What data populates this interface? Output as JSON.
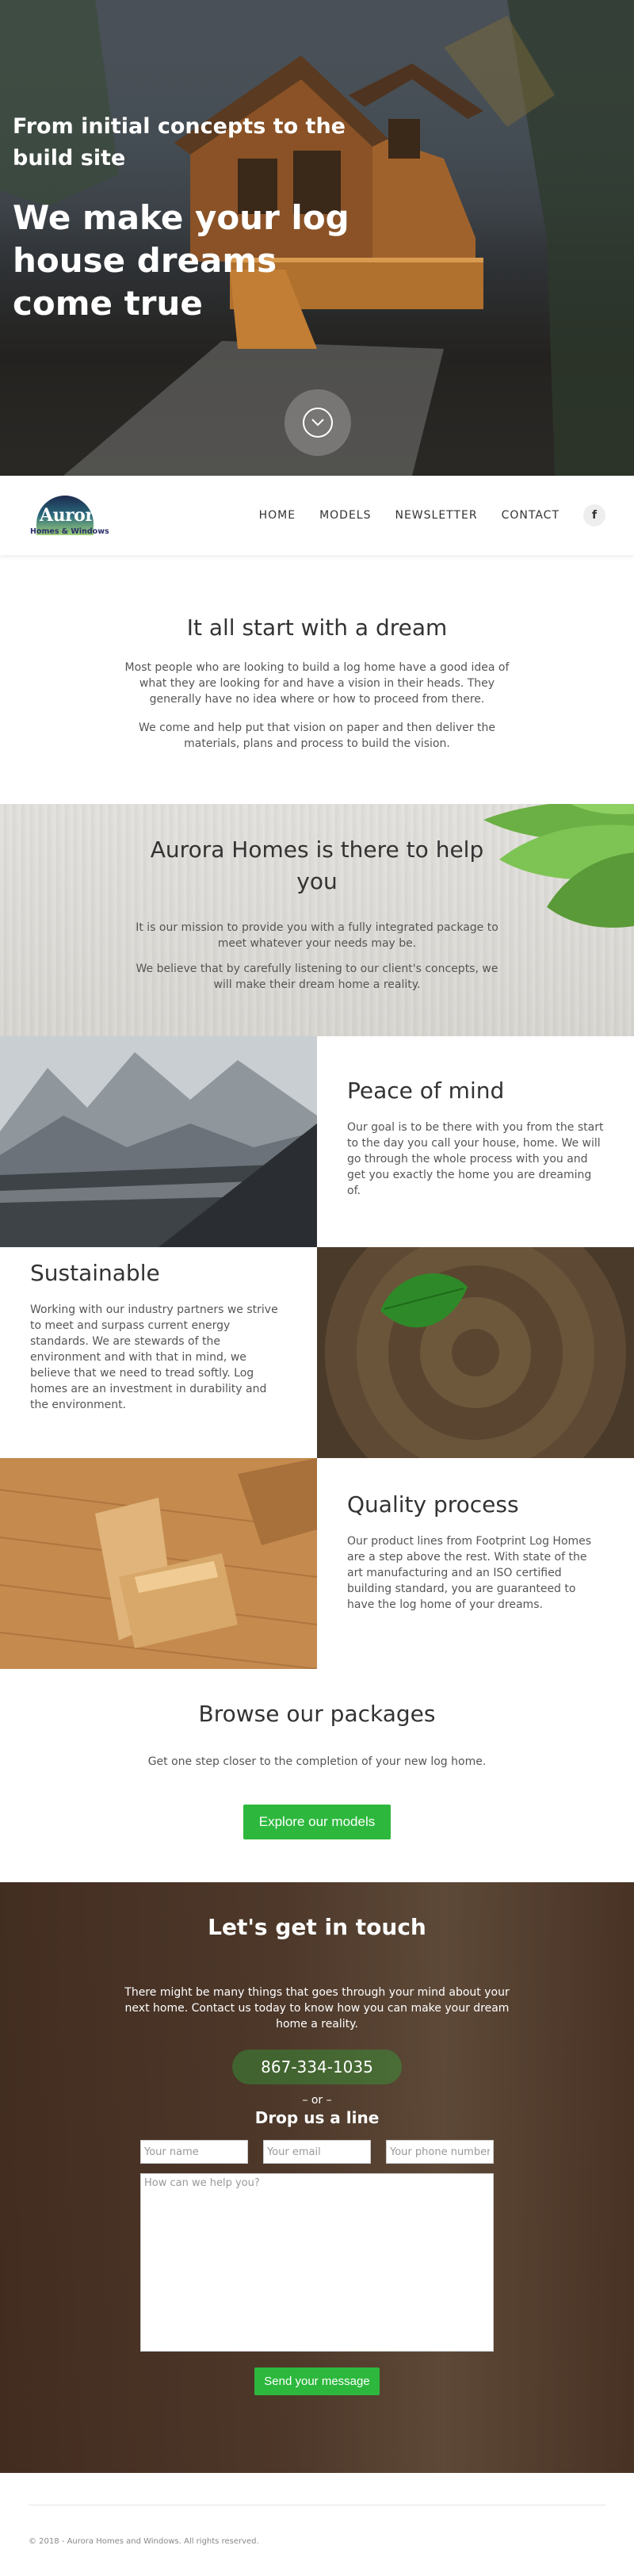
{
  "hero": {
    "subtitle": "From initial concepts to the build site",
    "title": "We make your log house dreams come true",
    "scroll_icon": "chevron-down-circle-icon"
  },
  "nav": {
    "logo_name": "Aurora",
    "logo_tag": "Homes & Windows",
    "items": [
      "HOME",
      "MODELS",
      "NEWSLETTER",
      "CONTACT"
    ],
    "social_icon": "f"
  },
  "dream": {
    "title": "It all start with a dream",
    "p1": "Most people who are looking to build a log home have a good idea of what they are looking for and have a vision in their heads. They generally have no idea where or how to proceed from there.",
    "p2": "We come and help put that vision on paper and then deliver the materials, plans and process to build the vision."
  },
  "mission": {
    "title": "Aurora Homes is there to help you",
    "p1": "It is our mission to provide you with a fully integrated package to meet whatever your needs may be.",
    "p2": "We believe that by carefully listening to our client's concepts, we will make their dream home a reality."
  },
  "features": [
    {
      "title": "Peace of mind",
      "body": "Our goal is to be there with you from the start to the day you call your house, home. We will go through the whole process with you and get you exactly the home you are dreaming of."
    },
    {
      "title": "Sustainable",
      "body": "Working with our industry partners we strive to meet and surpass current energy standards. We are stewards of the environment and with that in mind, we believe that we need to tread softly. Log homes are an investment in durability and the environment."
    },
    {
      "title": "Quality process",
      "body": "Our product lines from Footprint Log Homes are a step above the rest. With state of the art manufacturing and an ISO certified building standard, you are guaranteed to have the log home of your dreams."
    }
  ],
  "browse": {
    "title": "Browse our packages",
    "text": "Get one step closer to the completion of your new log home.",
    "button": "Explore our models"
  },
  "contact": {
    "title": "Let's get in touch",
    "text": "There might be many things that goes through your mind about your next home. Contact us today to know how you can make your dream home a reality.",
    "phone": "867-334-1035",
    "or": "– or –",
    "drop": "Drop us a line",
    "name_placeholder": "Your name",
    "email_placeholder": "Your email",
    "phone_placeholder": "Your phone number",
    "message_placeholder": "How can we help you?",
    "send": "Send your message"
  },
  "footer": {
    "text": "© 2018 - Aurora Homes and Windows. All rights reserved."
  }
}
